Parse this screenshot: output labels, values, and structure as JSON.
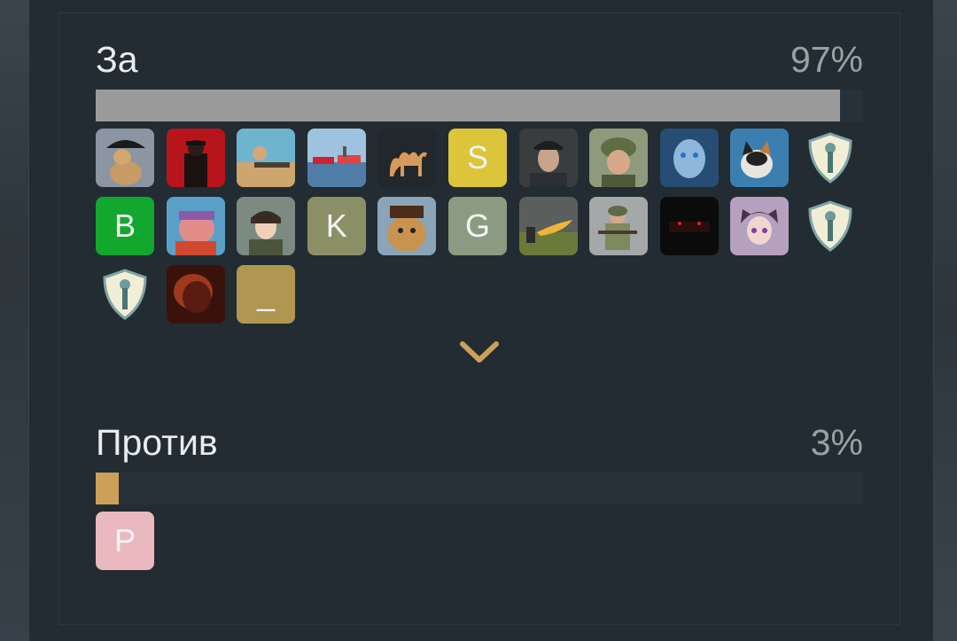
{
  "poll": {
    "options": [
      {
        "label": "За",
        "percent_text": "97%",
        "percent": 97,
        "fill_color": "#9a9a9a",
        "voters": [
          {
            "kind": "image",
            "icon": "camel-bicorne-avatar"
          },
          {
            "kind": "image",
            "icon": "red-officer-avatar"
          },
          {
            "kind": "image",
            "icon": "desert-gunner-avatar"
          },
          {
            "kind": "image",
            "icon": "ships-avatar"
          },
          {
            "kind": "image",
            "icon": "camel-silhouette-avatar"
          },
          {
            "kind": "letter",
            "letter": "S",
            "color": "#dcc53b"
          },
          {
            "kind": "image",
            "icon": "officer-portrait-avatar"
          },
          {
            "kind": "image",
            "icon": "soldier-helmet-avatar"
          },
          {
            "kind": "image",
            "icon": "night-king-avatar"
          },
          {
            "kind": "image",
            "icon": "cat-avatar"
          },
          {
            "kind": "image",
            "icon": "default-shield-avatar"
          },
          {
            "kind": "letter",
            "letter": "B",
            "color": "#11a82d"
          },
          {
            "kind": "image",
            "icon": "pig-king-avatar"
          },
          {
            "kind": "image",
            "icon": "anime-soldier-avatar"
          },
          {
            "kind": "letter",
            "letter": "K",
            "color": "#8b8f66"
          },
          {
            "kind": "image",
            "icon": "bear-ushanka-avatar"
          },
          {
            "kind": "letter",
            "letter": "G",
            "color": "#8b9b82"
          },
          {
            "kind": "image",
            "icon": "flamethrower-avatar"
          },
          {
            "kind": "image",
            "icon": "rifleman-avatar"
          },
          {
            "kind": "image",
            "icon": "dark-tank-avatar"
          },
          {
            "kind": "image",
            "icon": "anime-cat-girl-avatar"
          },
          {
            "kind": "image",
            "icon": "default-shield-avatar"
          },
          {
            "kind": "image",
            "icon": "default-shield-avatar"
          },
          {
            "kind": "image",
            "icon": "fire-silhouette-avatar"
          },
          {
            "kind": "letter",
            "letter": "_",
            "color": "#b09650"
          }
        ]
      },
      {
        "label": "Против",
        "percent_text": "3%",
        "percent": 3,
        "fill_color": "#cda05a",
        "voters": [
          {
            "kind": "letter",
            "letter": "P",
            "color": "#eab8bf"
          }
        ]
      }
    ],
    "expand_icon": "chevron-down-icon",
    "accent_color": "#cda05a"
  }
}
